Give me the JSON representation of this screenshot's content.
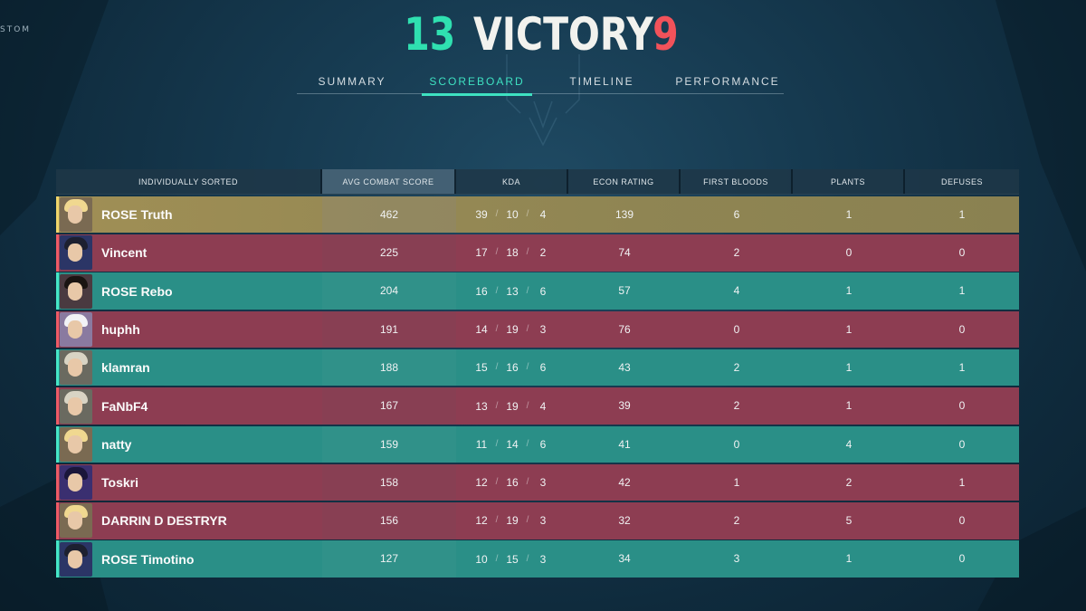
{
  "mode_label": "STOM",
  "header": {
    "score_left": "13",
    "result": "VICTORY",
    "score_right": "9"
  },
  "tabs": [
    {
      "label": "SUMMARY",
      "active": false
    },
    {
      "label": "SCOREBOARD",
      "active": true
    },
    {
      "label": "TIMELINE",
      "active": false
    },
    {
      "label": "PERFORMANCE",
      "active": false
    }
  ],
  "colors": {
    "team_a": "#2a8f87",
    "team_b": "#8d3d52",
    "self": "#a08f55",
    "accent": "#3ee1c1",
    "enemy_score": "#f2525a"
  },
  "columns": [
    "INDIVIDUALLY SORTED",
    "AVG COMBAT SCORE",
    "KDA",
    "ECON RATING",
    "FIRST BLOODS",
    "PLANTS",
    "DEFUSES"
  ],
  "players": [
    {
      "name": "ROSE Truth",
      "team": "self",
      "avatar": "blonde-agent-icon",
      "acs": "462",
      "k": "39",
      "d": "10",
      "a": "4",
      "econ": "139",
      "fb": "6",
      "plants": "1",
      "defuses": "1"
    },
    {
      "name": "Vincent",
      "team": "b",
      "avatar": "dark-hooded-agent-icon",
      "acs": "225",
      "k": "17",
      "d": "18",
      "a": "2",
      "econ": "74",
      "fb": "2",
      "plants": "0",
      "defuses": "0"
    },
    {
      "name": "ROSE Rebo",
      "team": "a",
      "avatar": "dark-hair-agent-icon",
      "acs": "204",
      "k": "16",
      "d": "13",
      "a": "6",
      "econ": "57",
      "fb": "4",
      "plants": "1",
      "defuses": "1"
    },
    {
      "name": "huphh",
      "team": "b",
      "avatar": "white-hair-agent-icon",
      "acs": "191",
      "k": "14",
      "d": "19",
      "a": "3",
      "econ": "76",
      "fb": "0",
      "plants": "1",
      "defuses": "0"
    },
    {
      "name": "klamran",
      "team": "a",
      "avatar": "hat-agent-icon",
      "acs": "188",
      "k": "15",
      "d": "16",
      "a": "6",
      "econ": "43",
      "fb": "2",
      "plants": "1",
      "defuses": "1"
    },
    {
      "name": "FaNbF4",
      "team": "b",
      "avatar": "hat-agent-icon",
      "acs": "167",
      "k": "13",
      "d": "19",
      "a": "4",
      "econ": "39",
      "fb": "2",
      "plants": "1",
      "defuses": "0"
    },
    {
      "name": "natty",
      "team": "a",
      "avatar": "blonde-agent-icon",
      "acs": "159",
      "k": "11",
      "d": "14",
      "a": "6",
      "econ": "41",
      "fb": "0",
      "plants": "4",
      "defuses": "0"
    },
    {
      "name": "Toskri",
      "team": "b",
      "avatar": "masked-agent-icon",
      "acs": "158",
      "k": "12",
      "d": "16",
      "a": "3",
      "econ": "42",
      "fb": "1",
      "plants": "2",
      "defuses": "1"
    },
    {
      "name": "DARRIN D DESTRYR",
      "team": "b",
      "avatar": "blonde-agent-icon",
      "acs": "156",
      "k": "12",
      "d": "19",
      "a": "3",
      "econ": "32",
      "fb": "2",
      "plants": "5",
      "defuses": "0"
    },
    {
      "name": "ROSE Timotino",
      "team": "a",
      "avatar": "dark-hooded-agent-icon",
      "acs": "127",
      "k": "10",
      "d": "15",
      "a": "3",
      "econ": "34",
      "fb": "3",
      "plants": "1",
      "defuses": "0"
    }
  ]
}
